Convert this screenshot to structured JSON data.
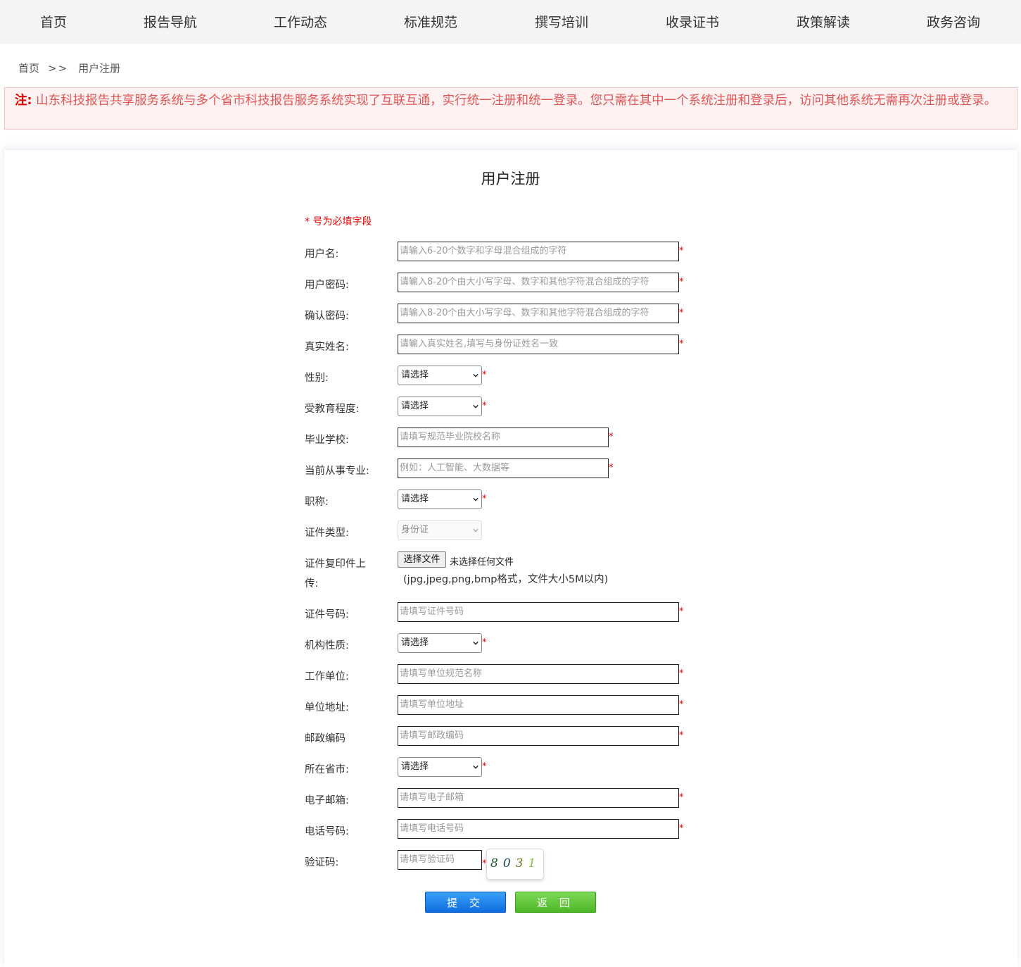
{
  "nav": [
    "首页",
    "报告导航",
    "工作动态",
    "标准规范",
    "撰写培训",
    "收录证书",
    "政策解读",
    "政务咨询"
  ],
  "breadcrumb": {
    "home": "首页",
    "separator": ">>",
    "current": "用户注册"
  },
  "notice": {
    "prefix": "注:",
    "text": "山东科技报告共享服务系统与多个省市科技报告服务系统实现了互联互通，实行统一注册和统一登录。您只需在其中一个系统注册和登录后，访问其他系统无需再次注册或登录。"
  },
  "form": {
    "title": "用户注册",
    "required_note": "* 号为必填字段",
    "required_mark": "*",
    "fields": {
      "username": {
        "label": "用户名:",
        "placeholder": "请输入6-20个数字和字母混合组成的字符"
      },
      "password": {
        "label": "用户密码:",
        "placeholder": "请输入8-20个由大小写字母、数字和其他字符混合组成的字符"
      },
      "confirm_password": {
        "label": "确认密码:",
        "placeholder": "请输入8-20个由大小写字母、数字和其他字符混合组成的字符"
      },
      "real_name": {
        "label": "真实姓名:",
        "placeholder": "请输入真实姓名,填写与身份证姓名一致"
      },
      "gender": {
        "label": "性别:",
        "value": "请选择"
      },
      "education": {
        "label": "受教育程度:",
        "value": "请选择"
      },
      "school": {
        "label": "毕业学校:",
        "placeholder": "请填写规范毕业院校名称"
      },
      "major": {
        "label": "当前从事专业:",
        "placeholder": "例如：人工智能、大数据等"
      },
      "title": {
        "label": "职称:",
        "value": "请选择"
      },
      "id_type": {
        "label": "证件类型:",
        "value": "身份证"
      },
      "id_upload": {
        "label_line1": "证件复印件上",
        "label_line2": "传:",
        "button": "选择文件",
        "status": "未选择任何文件",
        "hint": "(jpg,jpeg,png,bmp格式，文件大小5M以内)"
      },
      "id_number": {
        "label": "证件号码:",
        "placeholder": "请填写证件号码"
      },
      "org_type": {
        "label": "机构性质:",
        "value": "请选择"
      },
      "employer": {
        "label": "工作单位:",
        "placeholder": "请填写单位规范名称"
      },
      "address": {
        "label": "单位地址:",
        "placeholder": "请填写单位地址"
      },
      "postcode": {
        "label": "邮政编码",
        "placeholder": "请填写邮政编码"
      },
      "province": {
        "label": "所在省市:",
        "value": "请选择"
      },
      "email": {
        "label": "电子邮箱:",
        "placeholder": "请填写电子邮箱"
      },
      "phone": {
        "label": "电话号码:",
        "placeholder": "请填写电话号码"
      },
      "captcha": {
        "label": "验证码:",
        "placeholder": "请填写验证码",
        "digits": [
          "8",
          "0",
          "3",
          "1"
        ]
      }
    },
    "buttons": {
      "submit": "提 交",
      "back": "返 回"
    }
  },
  "colors": {
    "required": "#e00000",
    "notice_text": "#e05757",
    "submit": "#1a7fe8",
    "back": "#5cc534"
  },
  "icons": {
    "select_arrow": "chevron-down-icon"
  }
}
